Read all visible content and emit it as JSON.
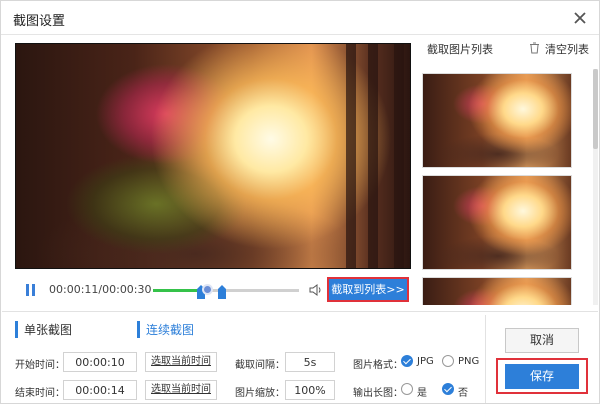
{
  "window": {
    "title": "截图设置",
    "close_icon": "close-icon"
  },
  "player": {
    "time_current": "00:00:11",
    "time_total": "00:00:30",
    "time_display": "00:00:11/00:00:30",
    "progress_fraction": 0.37,
    "range_start_fraction": 0.33,
    "range_end_fraction": 0.47,
    "capture_label": "截取到列表>>",
    "pause_icon": "pause-icon",
    "volume_icon": "volume-icon"
  },
  "list": {
    "title": "截取图片列表",
    "clear_label": "清空列表",
    "thumbnail_count": 3
  },
  "modes": {
    "single": "单张截图",
    "continuous": "连续截图"
  },
  "form": {
    "start_label": "开始时间：",
    "start_value": "00:00:10",
    "end_label": "结束时间：",
    "end_value": "00:00:14",
    "pick_current": "选取当前时间",
    "interval_label": "截取间隔：",
    "interval_value": "5s",
    "scale_label": "图片缩放：",
    "scale_value": "100%",
    "format_label": "图片格式：",
    "format_jpg": "JPG",
    "format_png": "PNG",
    "long_label": "输出长图：",
    "long_yes": "是",
    "long_no": "否"
  },
  "actions": {
    "cancel": "取消",
    "save": "保存"
  },
  "colors": {
    "accent": "#2d7fd9",
    "highlight": "#e0313a",
    "progress": "#35c24a"
  }
}
